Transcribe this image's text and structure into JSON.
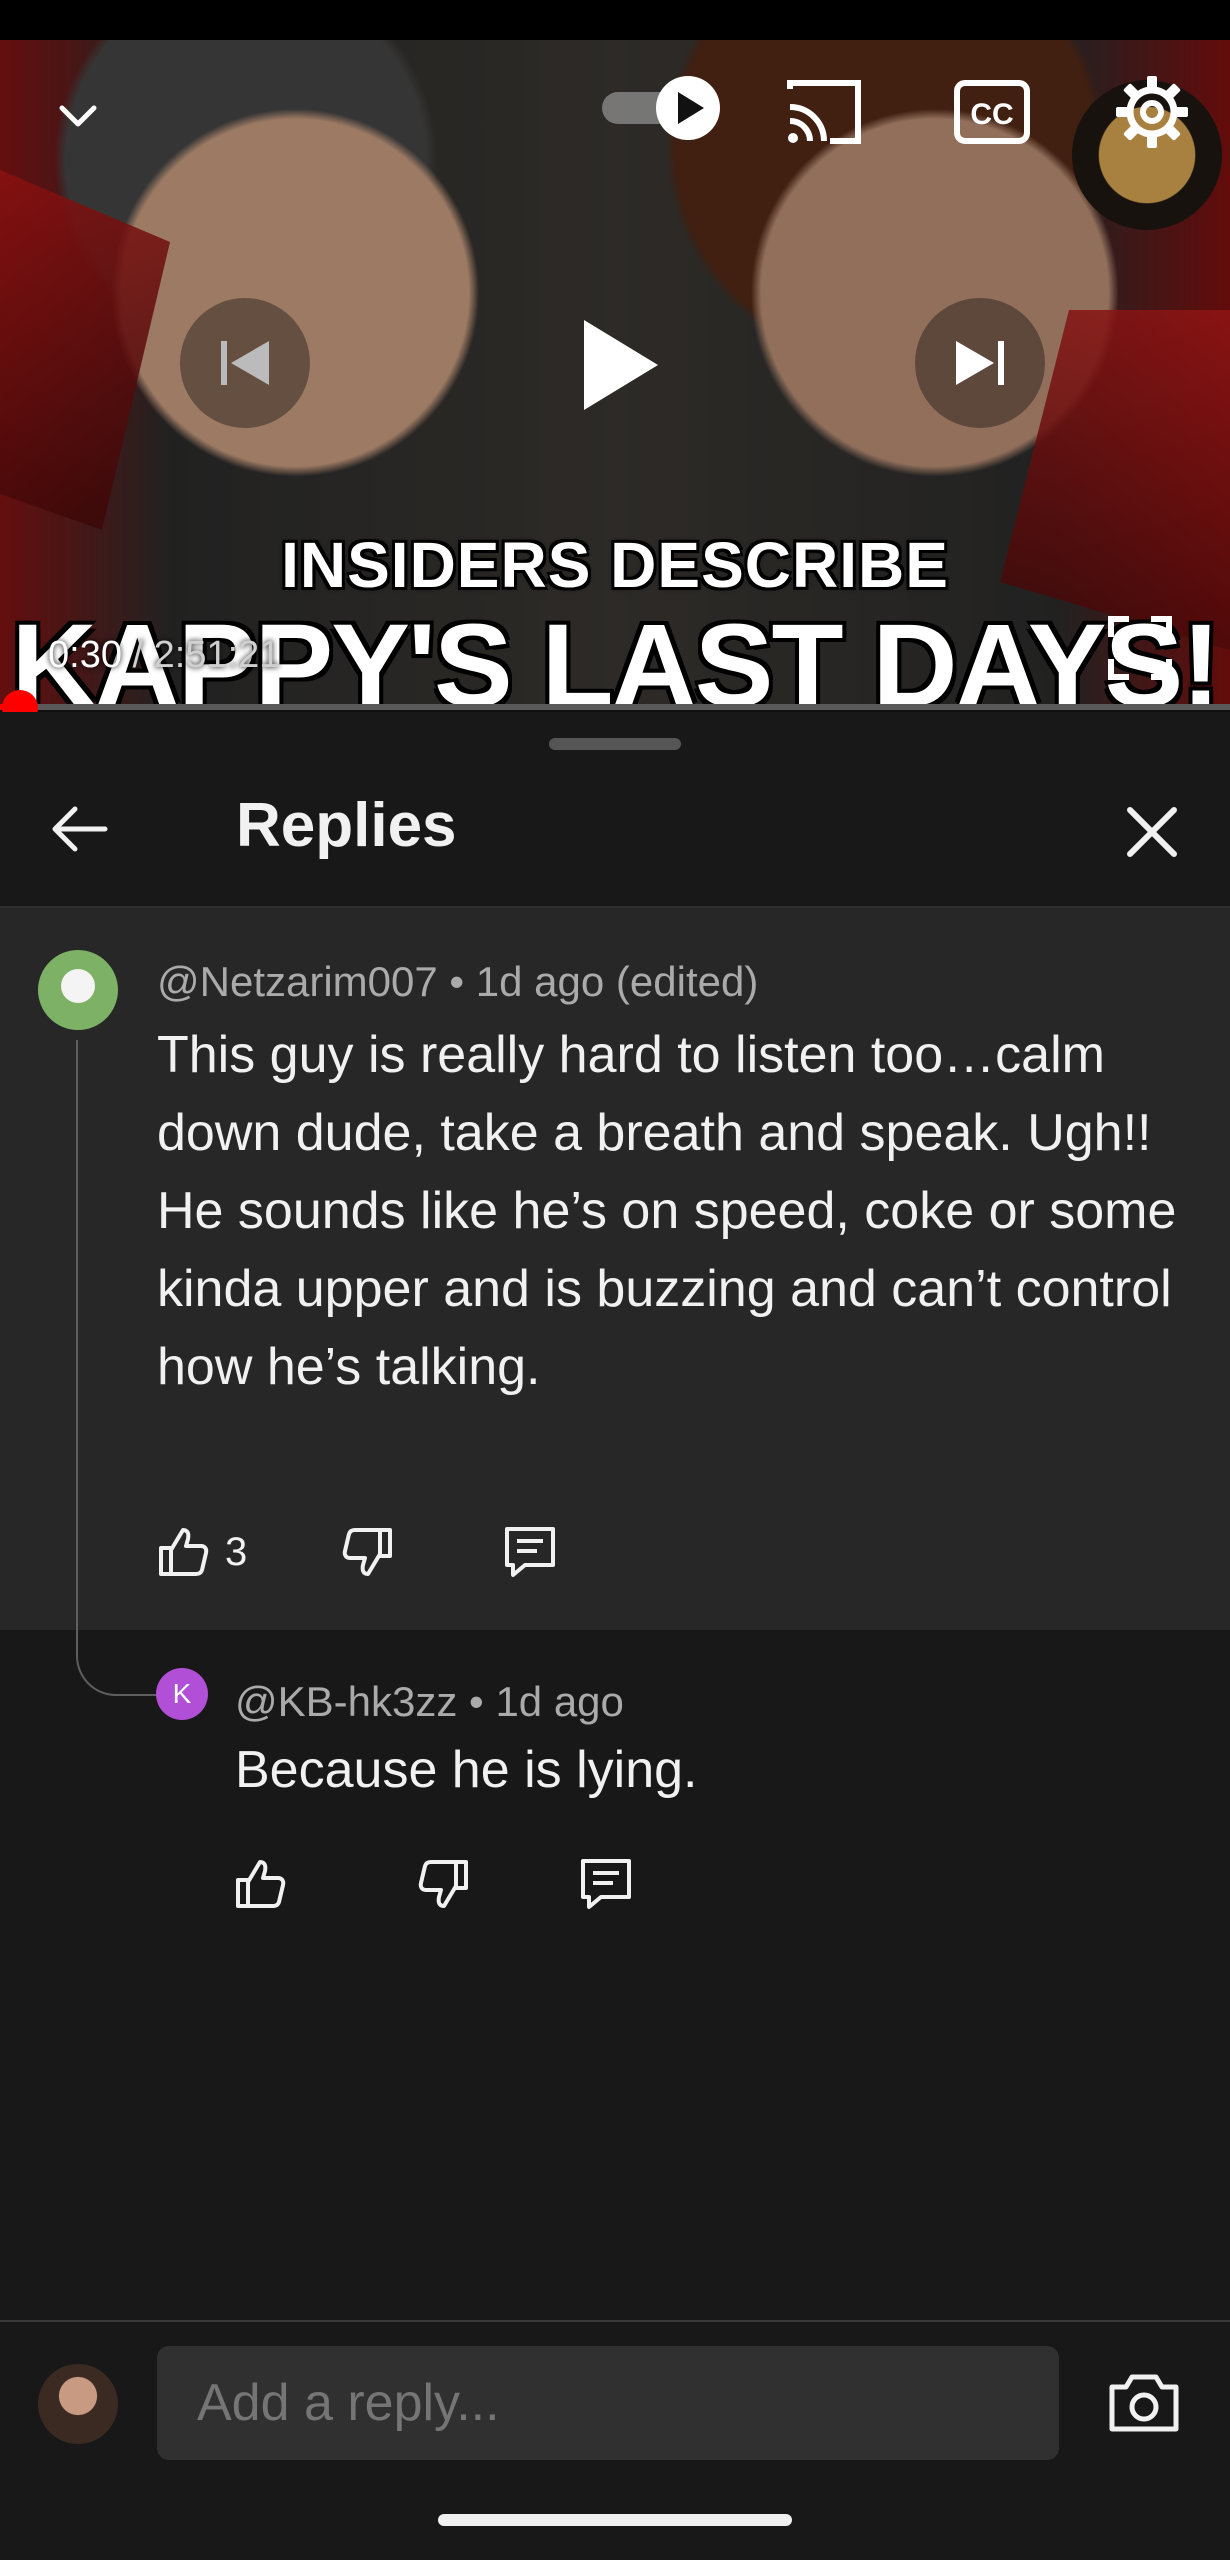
{
  "video": {
    "headline_line1": "INSIDERS DESCRIBE",
    "headline_line2": "KAPPY'S LAST DAYS!",
    "time_current": "0:30",
    "time_separator": " / ",
    "time_total": "2:51:21",
    "progress_fraction": 0.003,
    "icons": [
      "chevron-down-icon",
      "autoplay-toggle-icon",
      "cast-icon",
      "captions-icon",
      "settings-icon",
      "previous-icon",
      "play-icon",
      "next-icon",
      "fullscreen-icon"
    ],
    "captions_label": "CC"
  },
  "panel": {
    "title": "Replies",
    "back_icon": "arrow-left-icon",
    "close_icon": "close-icon"
  },
  "comment": {
    "author": "@Netzarim007",
    "age": "1d ago (edited)",
    "text_paragraph1": "This guy is really hard to listen too…calm down dude, take a breath and speak. Ugh!!",
    "text_paragraph2": "He sounds like he’s on speed, coke or some kinda upper and is buzzing and can’t control how he’s talking.",
    "likes": "3"
  },
  "reply": {
    "avatar_letter": "K",
    "author": "@KB-hk3zz",
    "age": "1d ago",
    "text": "Because he is lying."
  },
  "composer": {
    "placeholder": "Add a reply...",
    "camera_icon": "camera-icon"
  },
  "colors": {
    "background": "#0f0f0f",
    "comment_highlight": "#272727",
    "progress": "#ff0000",
    "reply_avatar": "#b14fd6"
  }
}
